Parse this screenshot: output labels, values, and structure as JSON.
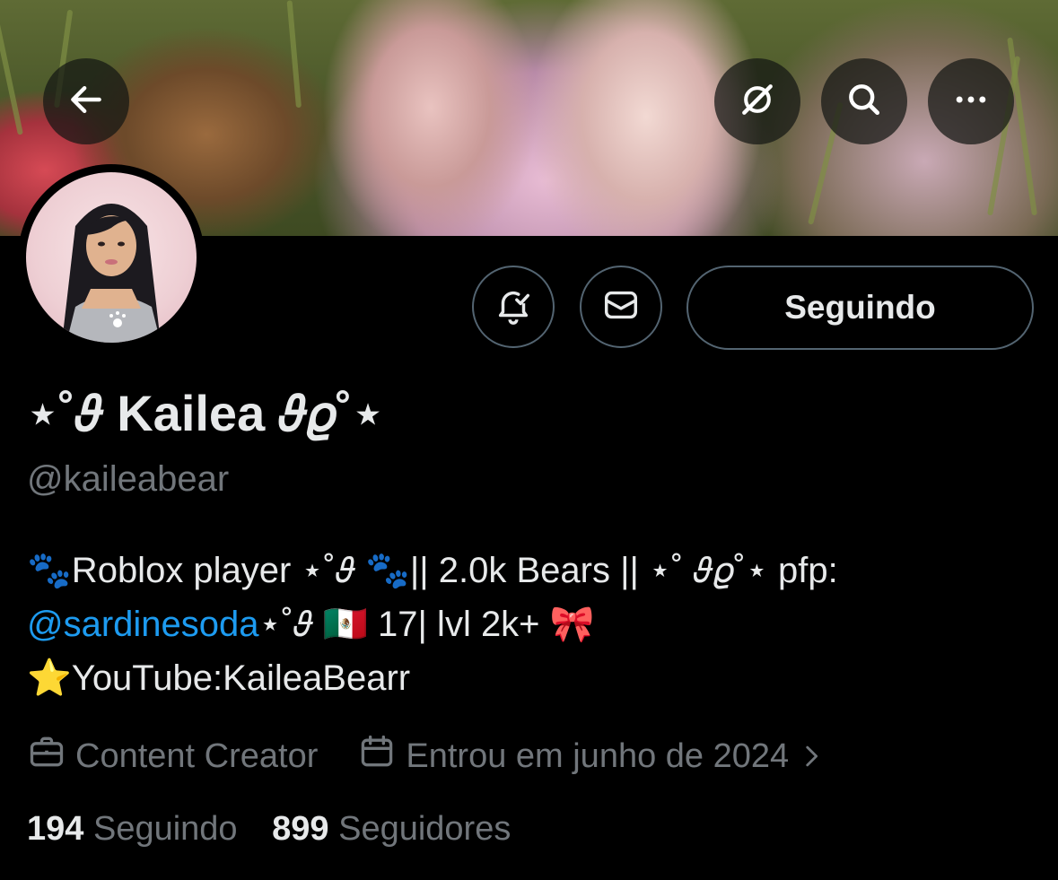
{
  "profile": {
    "display_name": "⋆˚𝜗 Kailea 𝜗𝜚˚⋆",
    "handle": "@kaileabear",
    "follow_status_label": "Seguindo",
    "bio": {
      "line1": "🐾Roblox player ⋆˚𝜗 🐾|| 2.0k Bears || ⋆˚ 𝜗𝜚˚⋆ pfp:",
      "mention": "@sardinesoda",
      "line2_rest": "⋆˚𝜗 🇲🇽 17| lvl 2k+ 🎀",
      "line3": "⭐YouTube:KaileaBearr"
    },
    "category": "Content Creator",
    "joined": "Entrou em junho de 2024",
    "following_count": "194",
    "following_label": "Seguindo",
    "followers_count": "899",
    "followers_label": "Seguidores"
  },
  "icons": {
    "back": "arrow-left-icon",
    "grok": "grok-icon",
    "search": "search-icon",
    "more": "more-icon",
    "notifications": "bell-check-icon",
    "message": "envelope-icon",
    "category": "briefcase-icon",
    "joined": "calendar-icon",
    "chevron": "chevron-right-icon"
  },
  "colors": {
    "background": "#000000",
    "text_primary": "#e7e9ea",
    "text_secondary": "#71767b",
    "link": "#1d9bf0",
    "border": "#536471"
  }
}
